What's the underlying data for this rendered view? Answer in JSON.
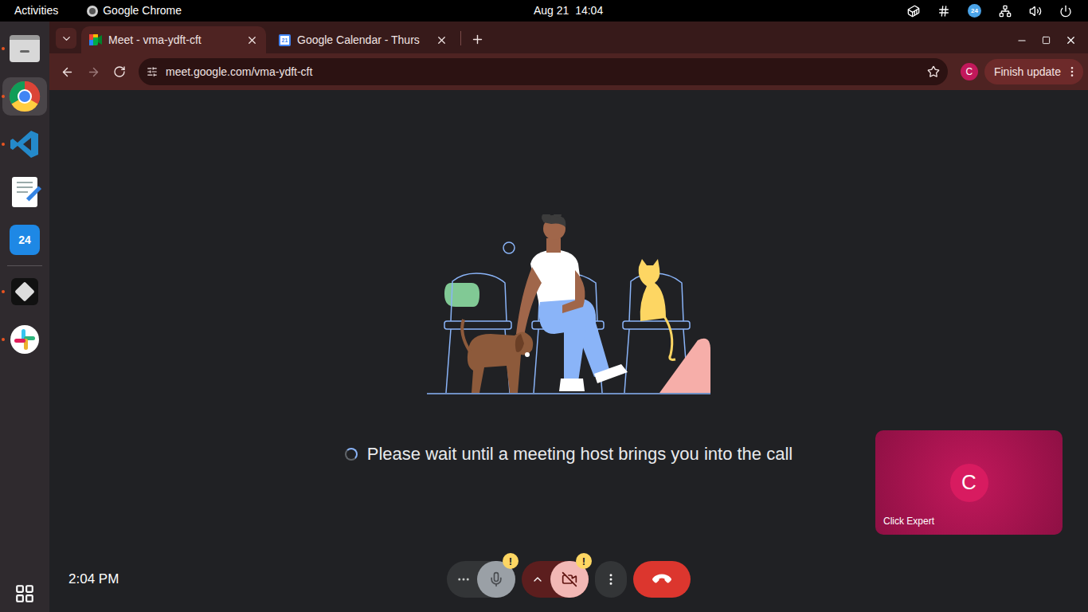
{
  "topbar": {
    "activities": "Activities",
    "app": "Google Chrome",
    "clock": "Aug 21  14:04",
    "tray": [
      {
        "kind": "docker"
      },
      {
        "kind": "slack"
      },
      {
        "kind": "calendar24",
        "label": "24"
      },
      {
        "kind": "network"
      },
      {
        "kind": "volume"
      },
      {
        "kind": "power"
      }
    ]
  },
  "dock": {
    "items": [
      {
        "kind": "files",
        "running": true,
        "selected": false
      },
      {
        "kind": "chrome",
        "running": true,
        "selected": true
      },
      {
        "kind": "vscode",
        "running": true,
        "selected": false
      },
      {
        "kind": "editor",
        "running": false,
        "selected": false
      },
      {
        "kind": "calendar24",
        "label": "24",
        "running": false,
        "selected": false
      },
      {
        "kind": "box",
        "running": true,
        "selected": false
      },
      {
        "kind": "slack",
        "running": true,
        "selected": false
      }
    ]
  },
  "browser": {
    "tabs": [
      {
        "label": "Meet - vma-ydft-cft",
        "selected": true,
        "favicon": "meet"
      },
      {
        "label": "Google Calendar - Thurs",
        "selected": false,
        "favicon": "calendar",
        "favicon_text": "21"
      }
    ],
    "url": "meet.google.com/vma-ydft-cft",
    "bookmarked": false,
    "profile": "C",
    "update_button": "Finish update"
  },
  "meet": {
    "message": "Please wait until a meeting host brings you into the call",
    "self_tile": {
      "initial": "C",
      "name": "Click Expert"
    },
    "time": "2:04 PM",
    "mic": {
      "available": false,
      "badge": "!"
    },
    "camera": {
      "off": true,
      "badge": "!"
    }
  }
}
